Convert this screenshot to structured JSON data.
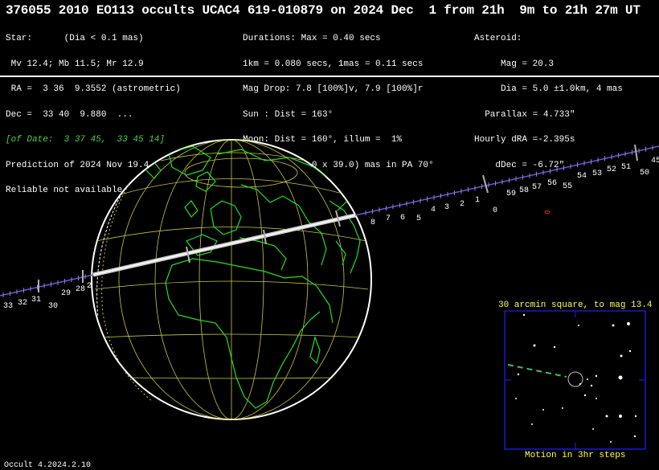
{
  "header": {
    "title": "376055 2010 EO113 occults UCAC4 619-010879 on 2024 Dec  1 from 21h  9m to 21h 27m UT"
  },
  "star": {
    "line1": "Star:      (Dia < 0.1 mas)",
    "line2": " Mv 12.4; Mb 11.5; Mr 12.9",
    "line3": " RA =  3 36  9.3552 (astrometric)",
    "line4": "Dec =  33 40  9.880  ...",
    "line5": "[of Date:  3 37 45,  33 45 14]",
    "line6": "Prediction of 2024 Nov 19.4",
    "line7": "Reliable not available"
  },
  "event": {
    "line1": "Durations: Max = 0.40 secs",
    "line2": "1km = 0.080 secs, 1mas = 0.11 secs",
    "line3": "Mag Drop: 7.8 [100%]v, 7.9 [100%]r",
    "line4": "Sun : Dist = 163°",
    "line5": "Moon: Dist = 160°, illum =  1%",
    "line6": "1σ Err: ±(73.0 x 39.0) mas in PA 70°"
  },
  "asteroid": {
    "line1": "Asteroid:",
    "line2": "     Mag = 20.3",
    "line3": "     Dia = 5.0 ±1.0km, 4 mas",
    "line4": "  Parallax = 4.733\"",
    "line5": "Hourly dRA =-2.395s",
    "line6": "    dDec = -6.72\""
  },
  "path_ticks": {
    "left_labels": [
      "33",
      "32",
      "31",
      "30",
      "29",
      "28",
      "2"
    ],
    "right_labels": [
      "8",
      "7",
      "6",
      "5",
      "4",
      "3",
      "2",
      "1",
      "0",
      "59",
      "58",
      "57",
      "56",
      "55",
      "54",
      "53",
      "52",
      "51",
      "50",
      "45"
    ]
  },
  "inset": {
    "title": "30 arcmin square, to mag 13.4",
    "caption": "Motion in 3hr steps"
  },
  "footer": {
    "version": "Occult 4.2024.2.10"
  },
  "colors": {
    "background": "#000000",
    "text": "#ffffff",
    "star_date_text": "#4cd24c",
    "coastline": "#22e022",
    "grid": "#c8c83c",
    "inset_frame": "#2020ff",
    "inset_text": "#ffff40",
    "motion_path": "#40c060",
    "marker": "#ff2020"
  }
}
